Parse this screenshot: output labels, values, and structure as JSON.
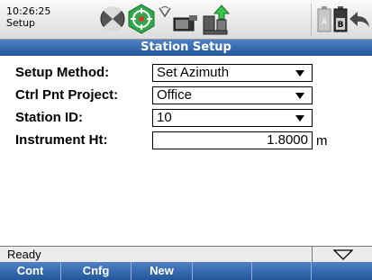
{
  "status": {
    "time": "10:26:25",
    "screen": "Setup"
  },
  "icons": {
    "target": "target-icon",
    "prism": "prism-icon",
    "radio": "radio-signal-icon",
    "link": "data-link-icon",
    "instrument": "instrument-up-icon",
    "battery_a": "battery-a-icon",
    "battery_b": "battery-b-icon",
    "back": "back-arrow-icon"
  },
  "title": "Station Setup",
  "form": {
    "setup_method": {
      "label": "Setup Method:",
      "value": "Set Azimuth"
    },
    "ctrl_project": {
      "label": "Ctrl Pnt Project:",
      "value": "Office"
    },
    "station_id": {
      "label": "Station ID:",
      "value": "10"
    },
    "instrument_ht": {
      "label": "Instrument Ht:",
      "value": "1.8000",
      "unit": "m"
    }
  },
  "statusline": {
    "text": "Ready"
  },
  "softkeys": [
    "Cont",
    "Cnfg",
    "New",
    "",
    "",
    ""
  ],
  "colors": {
    "title_bar": "#2f63a8",
    "accent_green": "#2fa84a"
  }
}
